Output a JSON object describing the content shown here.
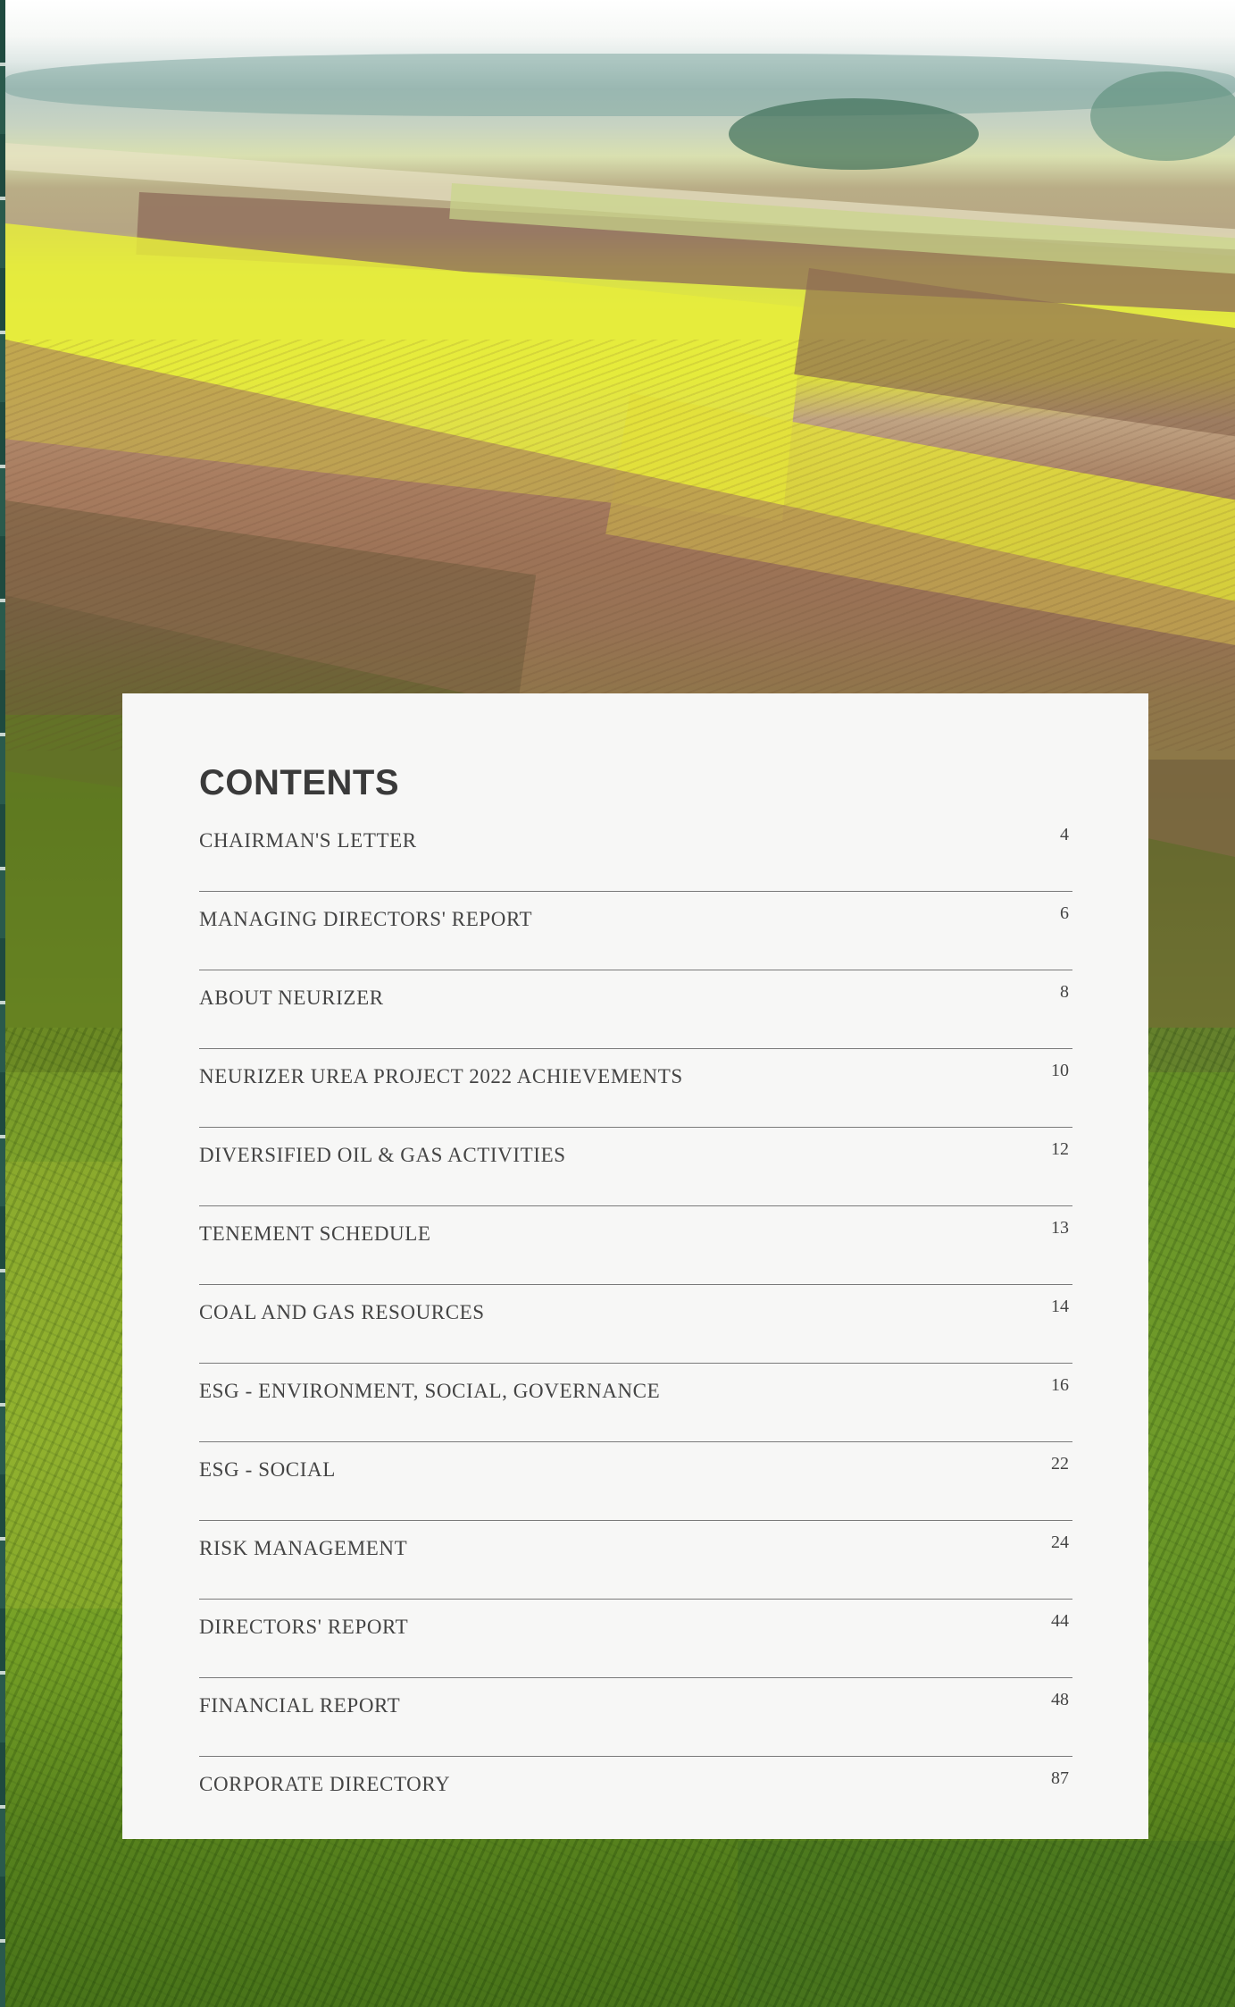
{
  "contents": {
    "title": "CONTENTS",
    "items": [
      {
        "label": "CHAIRMAN'S LETTER",
        "page": "4"
      },
      {
        "label": "MANAGING DIRECTORS' REPORT",
        "page": "6"
      },
      {
        "label": "ABOUT NEURIZER",
        "page": "8"
      },
      {
        "label": "NEURIZER UREA PROJECT 2022 ACHIEVEMENTS",
        "page": "10"
      },
      {
        "label": "DIVERSIFIED OIL & GAS ACTIVITIES",
        "page": "12"
      },
      {
        "label": "TENEMENT SCHEDULE",
        "page": "13"
      },
      {
        "label": "COAL AND GAS RESOURCES",
        "page": "14"
      },
      {
        "label": "ESG - ENVIRONMENT, SOCIAL, GOVERNANCE",
        "page": "16"
      },
      {
        "label": "ESG - SOCIAL",
        "page": "22"
      },
      {
        "label": "RISK MANAGEMENT",
        "page": "24"
      },
      {
        "label": "DIRECTORS' REPORT",
        "page": "44"
      },
      {
        "label": "FINANCIAL REPORT",
        "page": "48"
      },
      {
        "label": "CORPORATE DIRECTORY",
        "page": "87"
      }
    ]
  }
}
